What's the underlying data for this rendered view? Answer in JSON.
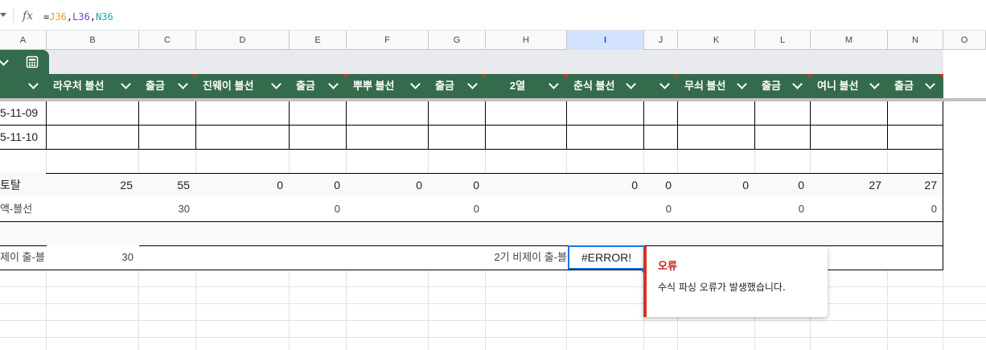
{
  "formula_bar": {
    "fx_label": "fx",
    "formula_parts": [
      {
        "text": "=",
        "color": "#202124"
      },
      {
        "text": "J36",
        "color": "#e8a317"
      },
      {
        "text": ",",
        "color": "#202124"
      },
      {
        "text": "L36",
        "color": "#7b3fbf"
      },
      {
        "text": ",",
        "color": "#202124"
      },
      {
        "text": "N36",
        "color": "#1aa6a6"
      }
    ]
  },
  "columns": [
    "A",
    "B",
    "C",
    "D",
    "E",
    "F",
    "G",
    "H",
    "I",
    "J",
    "K",
    "L",
    "M",
    "N",
    "O"
  ],
  "selected_column": "I",
  "table_tab_icon": "calculator-icon",
  "headers": {
    "A": "",
    "B": "라우처 블선",
    "C": "출금",
    "D": "진웨이 블선",
    "E": "출금",
    "F": "뿌뿌 블선",
    "G": "출금",
    "H": "2열",
    "I": "춘식 블선",
    "J": "",
    "K": "무쇠 블선",
    "L": "출금",
    "M": "여니 블선",
    "N": "출금"
  },
  "rows": {
    "dates": [
      "5-11-09",
      "5-11-10"
    ],
    "total": {
      "label": "토탈",
      "B": "25",
      "C": "55",
      "D": "0",
      "E": "0",
      "F": "0",
      "G": "0",
      "I": "0",
      "J": "0",
      "K": "0",
      "L": "0",
      "M": "27",
      "N": "27"
    },
    "balance": {
      "label": "액-블선",
      "C": "30",
      "E": "0",
      "G": "0",
      "J": "0",
      "L": "0",
      "N": "0"
    },
    "footer": {
      "a_label": "제이 출-블",
      "b_value": "30",
      "h_label": "2기 비제이 출-블",
      "i_value": "#ERROR!"
    }
  },
  "error_popup": {
    "title": "오류",
    "message": "수식 파싱 오류가 발생했습니다."
  },
  "colors": {
    "header_green": "#346b4c",
    "error_red": "#d93025",
    "selection_blue": "#1a73e8"
  }
}
